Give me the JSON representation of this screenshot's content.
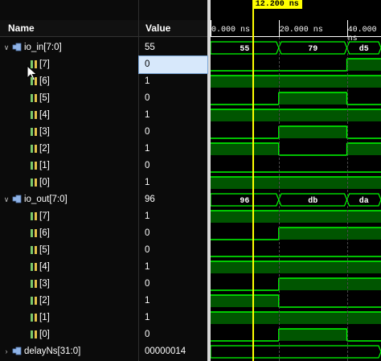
{
  "columns": {
    "name": "Name",
    "value": "Value"
  },
  "cursor": {
    "label": "12.200 ns",
    "time": 12.2
  },
  "timeline": {
    "view_start_ns": 0,
    "view_end_ns": 50,
    "ticks": [
      {
        "time": 0,
        "label": "0.000 ns"
      },
      {
        "time": 20,
        "label": "20.000 ns"
      },
      {
        "time": 40,
        "label": "40.000 ns"
      }
    ]
  },
  "colors": {
    "wave": "#00ff00",
    "wave_fill": "#005500",
    "cursor": "#ffff00",
    "bus_outline": "#00ff00"
  },
  "signals": [
    {
      "type": "bus",
      "name": "io_in[7:0]",
      "value": "55",
      "expanded": true,
      "segments": [
        {
          "from": 0,
          "to": 20,
          "label": "55"
        },
        {
          "from": 20,
          "to": 40,
          "label": "79"
        },
        {
          "from": 40,
          "to": 50,
          "label": "d5"
        }
      ]
    },
    {
      "type": "bit",
      "name": "[7]",
      "value": "0",
      "selected": true,
      "levels": [
        0,
        0,
        1
      ]
    },
    {
      "type": "bit",
      "name": "[6]",
      "value": "1",
      "levels": [
        1,
        1,
        1
      ]
    },
    {
      "type": "bit",
      "name": "[5]",
      "value": "0",
      "levels": [
        0,
        1,
        0
      ]
    },
    {
      "type": "bit",
      "name": "[4]",
      "value": "1",
      "levels": [
        1,
        1,
        1
      ]
    },
    {
      "type": "bit",
      "name": "[3]",
      "value": "0",
      "levels": [
        0,
        1,
        0
      ]
    },
    {
      "type": "bit",
      "name": "[2]",
      "value": "1",
      "levels": [
        1,
        0,
        1
      ]
    },
    {
      "type": "bit",
      "name": "[1]",
      "value": "0",
      "levels": [
        0,
        0,
        0
      ]
    },
    {
      "type": "bit",
      "name": "[0]",
      "value": "1",
      "levels": [
        1,
        1,
        1
      ]
    },
    {
      "type": "bus",
      "name": "io_out[7:0]",
      "value": "96",
      "expanded": true,
      "segments": [
        {
          "from": 0,
          "to": 20,
          "label": "96"
        },
        {
          "from": 20,
          "to": 40,
          "label": "db"
        },
        {
          "from": 40,
          "to": 50,
          "label": "da"
        }
      ]
    },
    {
      "type": "bit",
      "name": "[7]",
      "value": "1",
      "levels": [
        1,
        1,
        1
      ]
    },
    {
      "type": "bit",
      "name": "[6]",
      "value": "0",
      "levels": [
        0,
        1,
        1
      ]
    },
    {
      "type": "bit",
      "name": "[5]",
      "value": "0",
      "levels": [
        0,
        0,
        0
      ]
    },
    {
      "type": "bit",
      "name": "[4]",
      "value": "1",
      "levels": [
        1,
        1,
        1
      ]
    },
    {
      "type": "bit",
      "name": "[3]",
      "value": "0",
      "levels": [
        0,
        1,
        1
      ]
    },
    {
      "type": "bit",
      "name": "[2]",
      "value": "1",
      "levels": [
        1,
        0,
        0
      ]
    },
    {
      "type": "bit",
      "name": "[1]",
      "value": "1",
      "levels": [
        1,
        1,
        1
      ]
    },
    {
      "type": "bit",
      "name": "[0]",
      "value": "0",
      "levels": [
        0,
        1,
        0
      ]
    },
    {
      "type": "bus",
      "name": "delayNs[31:0]",
      "value": "00000014",
      "expanded": false,
      "segments": [
        {
          "from": 0,
          "to": 50,
          "label": ""
        }
      ]
    }
  ]
}
